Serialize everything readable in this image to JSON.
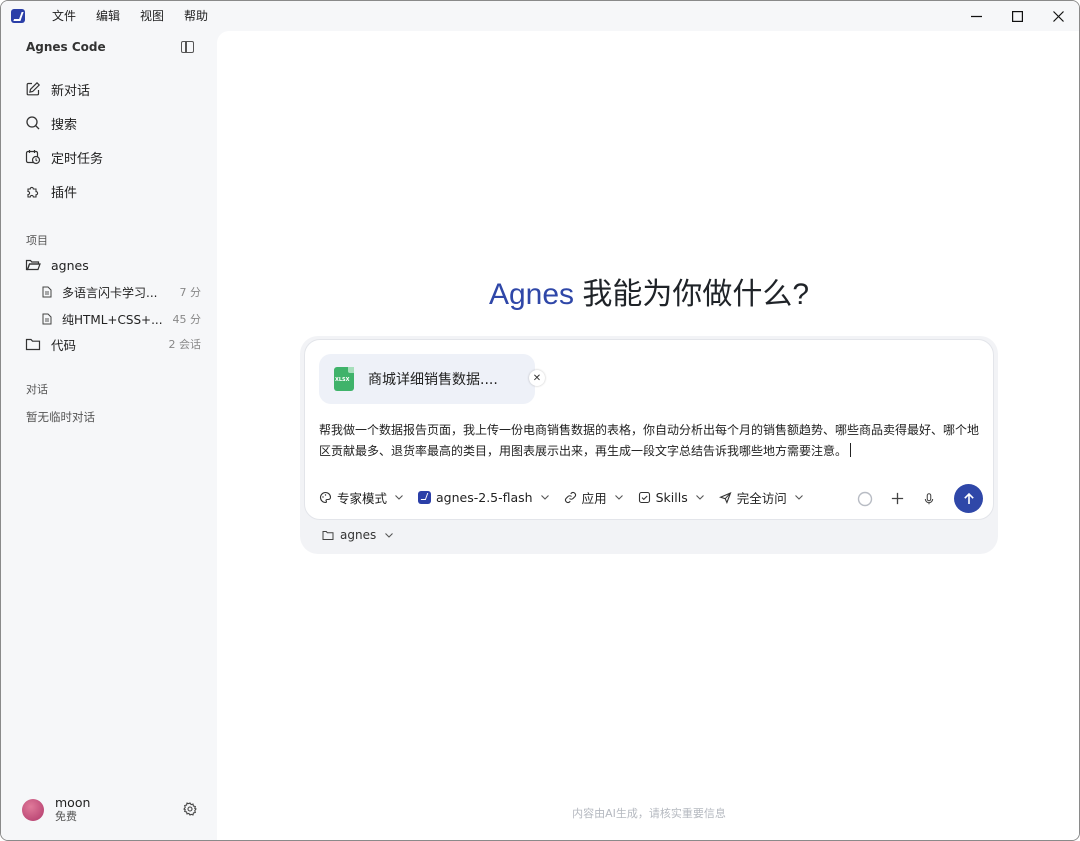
{
  "menu": [
    "文件",
    "编辑",
    "视图",
    "帮助"
  ],
  "sidebar": {
    "brand": "Agnes Code",
    "nav": [
      {
        "label": "新对话",
        "icon": "edit-icon"
      },
      {
        "label": "搜索",
        "icon": "search-icon"
      },
      {
        "label": "定时任务",
        "icon": "calendar-clock-icon"
      },
      {
        "label": "插件",
        "icon": "plugin-icon"
      }
    ],
    "projects_label": "项目",
    "projects": [
      {
        "name": "agnes",
        "meta": ""
      },
      {
        "name": "代码",
        "meta": "2 会话"
      }
    ],
    "sessions": [
      {
        "name": "多语言闪卡学习...",
        "time": "7 分"
      },
      {
        "name": "纯HTML+CSS+...",
        "time": "45 分"
      }
    ],
    "chats_label": "对话",
    "chats_empty": "暂无临时对话",
    "user": {
      "name": "moon",
      "plan": "免费"
    }
  },
  "main": {
    "hero_accent": "Agnes",
    "hero_rest": " 我能为你做什么?",
    "attachment": {
      "name": "商城详细销售数据....",
      "type": "XLSX"
    },
    "prompt": "帮我做一个数据报告页面，我上传一份电商销售数据的表格，你自动分析出每个月的销售额趋势、哪些商品卖得最好、哪个地区贡献最多、退货率最高的类目，用图表展示出来，再生成一段文字总结告诉我哪些地方需要注意。",
    "toolbar": {
      "mode": "专家模式",
      "model": "agnes-2.5-flash",
      "apps": "应用",
      "skills": "Skills",
      "access": "完全访问"
    },
    "folder": "agnes",
    "disclaimer": "内容由AI生成，请核实重要信息"
  },
  "colors": {
    "accent": "#2f47a8",
    "sidebar_bg": "#f6f7f9",
    "xlsx": "#3fb36a"
  }
}
